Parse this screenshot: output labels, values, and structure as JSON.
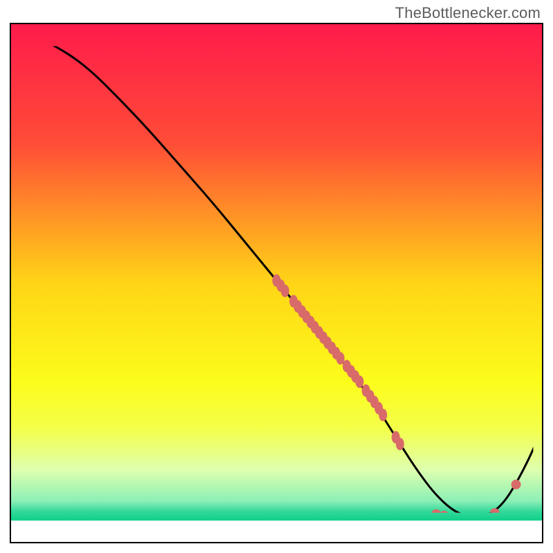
{
  "attribution": "TheBottlenecker.com",
  "chart_data": {
    "type": "line",
    "title": "",
    "xlabel": "",
    "ylabel": "",
    "xlim": [
      0,
      100
    ],
    "ylim": [
      0,
      100
    ],
    "gradient_stops": [
      {
        "offset": 0.0,
        "color": "#ff1b4b"
      },
      {
        "offset": 0.23,
        "color": "#ff4c37"
      },
      {
        "offset": 0.5,
        "color": "#ffd516"
      },
      {
        "offset": 0.69,
        "color": "#fcfc1b"
      },
      {
        "offset": 0.78,
        "color": "#f4ff4a"
      },
      {
        "offset": 0.86,
        "color": "#deffae"
      },
      {
        "offset": 0.92,
        "color": "#8cefb6"
      },
      {
        "offset": 0.94,
        "color": "#33d99a"
      },
      {
        "offset": 0.957,
        "color": "#10cf8a"
      },
      {
        "offset": 0.958,
        "color": "#ffffff"
      },
      {
        "offset": 1.0,
        "color": "#ffffff"
      }
    ],
    "series": [
      {
        "name": "curve",
        "x": [
          0,
          3,
          8,
          14,
          20,
          26,
          32,
          38,
          44,
          50,
          56,
          62,
          68,
          72,
          76,
          80,
          84,
          88,
          92,
          96,
          100
        ],
        "y": [
          100,
          98,
          96,
          92,
          86,
          79.5,
          72.5,
          65.5,
          58,
          50.5,
          43,
          35.5,
          27.5,
          21,
          14.5,
          9,
          5.5,
          4.7,
          6.5,
          13,
          22
        ]
      }
    ],
    "scatter_groups": [
      {
        "name": "line-markers",
        "color": "#d86a6a",
        "rx": 6,
        "ry": 9,
        "points_xy": [
          [
            50.0,
            50.5
          ],
          [
            50.8,
            49.5
          ],
          [
            51.6,
            48.5
          ],
          [
            53.2,
            46.5
          ],
          [
            54.0,
            45.5
          ],
          [
            54.8,
            44.5
          ],
          [
            55.6,
            43.5
          ],
          [
            56.4,
            42.5
          ],
          [
            57.2,
            41.5
          ],
          [
            58.0,
            40.5
          ],
          [
            58.8,
            39.5
          ],
          [
            59.6,
            38.5
          ],
          [
            60.4,
            37.5
          ],
          [
            61.2,
            36.5
          ],
          [
            62.0,
            35.5
          ],
          [
            63.2,
            34.0
          ],
          [
            64.0,
            33.0
          ],
          [
            64.8,
            32.0
          ],
          [
            65.6,
            31.0
          ],
          [
            66.8,
            29.3
          ],
          [
            67.6,
            28.2
          ],
          [
            68.4,
            27.1
          ],
          [
            69.2,
            25.9
          ],
          [
            70.0,
            24.6
          ],
          [
            72.4,
            20.3
          ],
          [
            73.2,
            19.0
          ]
        ]
      },
      {
        "name": "valley-markers",
        "color": "#d86a6a",
        "rx": 7,
        "ry": 7,
        "points_xy": [
          [
            80.0,
            5.5
          ],
          [
            81.5,
            5.2
          ],
          [
            84.0,
            4.9
          ],
          [
            86.0,
            4.7
          ],
          [
            87.3,
            4.7
          ],
          [
            91.0,
            5.7
          ],
          [
            95.0,
            11.2
          ]
        ]
      }
    ]
  }
}
